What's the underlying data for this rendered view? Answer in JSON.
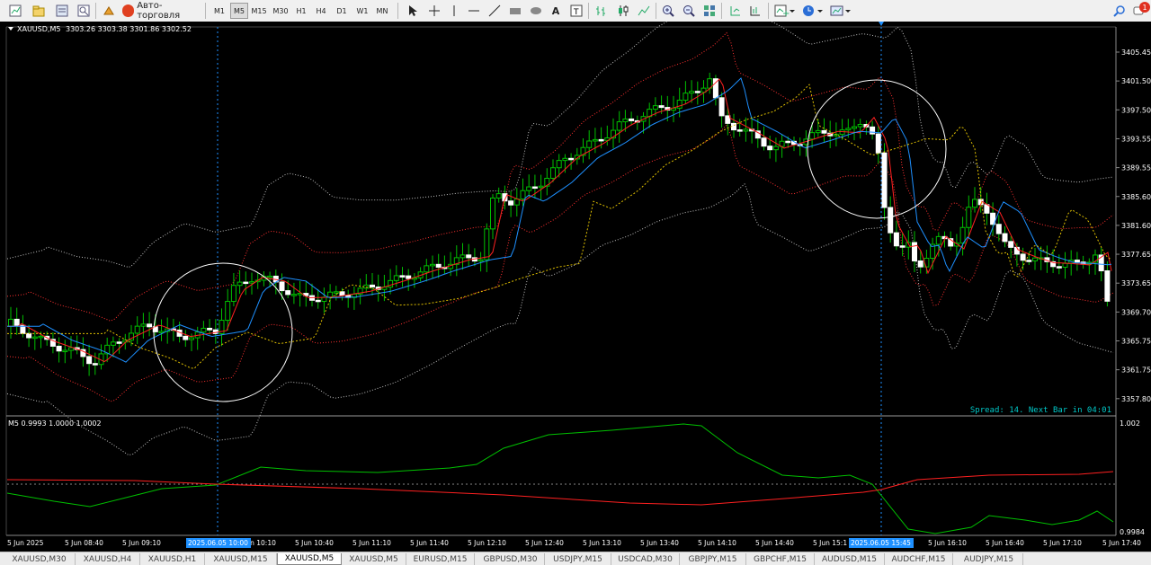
{
  "toolbar": {
    "autotrading_label": "Авто-торговля",
    "timeframes": [
      "M1",
      "M5",
      "M15",
      "M30",
      "H1",
      "H4",
      "D1",
      "W1",
      "MN"
    ],
    "active_timeframe": "M5",
    "notification_count": "1",
    "icons": [
      "new-chart-icon",
      "profiles-icon",
      "market-watch-icon",
      "navigator-icon",
      "strategy-tester-icon",
      "autotrading-icon",
      "cursor-icon",
      "crosshair-icon",
      "vertical-line-icon",
      "horizontal-line-icon",
      "trend-line-icon",
      "rectangle-icon",
      "ellipse-icon",
      "text-icon",
      "label-icon",
      "bar-chart-icon",
      "candlestick-icon",
      "line-chart-icon",
      "zoom-in-icon",
      "zoom-out-icon",
      "tile-windows-icon",
      "chart-shift-icon",
      "autoscroll-icon",
      "indicators-icon",
      "periods-icon",
      "templates-icon",
      "search-icon",
      "chat-icon"
    ]
  },
  "main_chart": {
    "symbol_info": "XAUUSD,M5",
    "ohlc": "3303.26 3303.38 3301.86 3302.52",
    "price_axis": [
      "3405.45",
      "3401.50",
      "3397.50",
      "3393.55",
      "3389.55",
      "3385.60",
      "3381.60",
      "3377.65",
      "3373.65",
      "3369.70",
      "3365.75",
      "3361.75",
      "3357.80"
    ],
    "spread_text": "Spread: 14. Next Bar in 04:01",
    "colors": {
      "background": "#000000",
      "candle_bull": "#00c000",
      "candle_bear": "#ffffff",
      "ma_red": "#ff2020",
      "ma_blue": "#1e90ff",
      "ma_yellow": "#e0c000",
      "bands_red": "#ff3030",
      "bands_white": "#c0c0c0",
      "text": "#ffffff",
      "accent": "#00c8c8"
    }
  },
  "indicator": {
    "label": "M5 0.9993 1.0000 1.0002",
    "axis_top": "1.002",
    "axis_bottom": "0.9984",
    "colors": {
      "green": "#00c000",
      "red": "#ff2020"
    }
  },
  "time_axis": {
    "labels": [
      "5 Jun 2025",
      "5 Jun 08:40",
      "5 Jun 09:10",
      "5 Jun 10:10",
      "5 Jun 10:40",
      "5 Jun 11:10",
      "5 Jun 11:40",
      "5 Jun 12:10",
      "5 Jun 12:40",
      "5 Jun 13:10",
      "5 Jun 13:40",
      "5 Jun 14:10",
      "5 Jun 14:40",
      "5 Jun 15:1",
      "5 Jun 16:10",
      "5 Jun 16:40",
      "5 Jun 17:10",
      "5 Jun 17:40"
    ],
    "highlights": [
      "2025.06.05 10:00",
      "2025.06.05 15:45"
    ]
  },
  "tabs": [
    "XAUUSD,M30",
    "XAUUSD,H4",
    "XAUUSD,H1",
    "XAUUSD,M15",
    "XAUUSD,M5",
    "XAUUSD,M5",
    "EURUSD,M15",
    "GBPUSD,M30",
    "USDJPY,M15",
    "USDCAD,M30",
    "GBPJPY,M15",
    "GBPCHF,M15",
    "AUDUSD,M15",
    "AUDCHF,M15",
    "AUDJPY,M15"
  ],
  "active_tab": "XAUUSD,M5"
}
